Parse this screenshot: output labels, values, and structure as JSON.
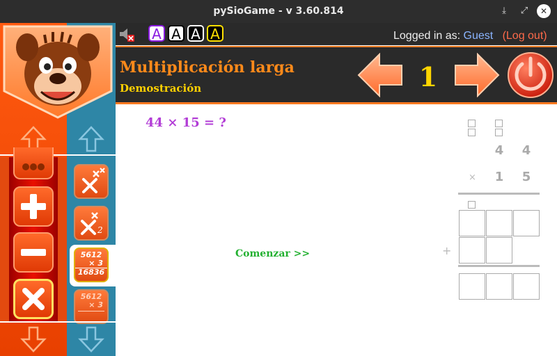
{
  "window": {
    "title": "pySioGame - v 3.60.814"
  },
  "header": {
    "game_title": "Multiplicación larga",
    "subtitle": "Demostración",
    "level": "1",
    "logged_in_label": "Logged in as:",
    "user": "Guest",
    "logout": "(Log out)",
    "font_buttons": [
      "A",
      "A",
      "A",
      "A"
    ]
  },
  "main": {
    "question": "44 × 15 = ?",
    "start_label": "Comenzar >>",
    "multiplicand": [
      "4",
      "4"
    ],
    "multiplier": [
      "1",
      "5"
    ],
    "times_sign": "×",
    "plus_sign": "+"
  },
  "sidebar": {
    "level_buttons": [
      {
        "top": "5612",
        "mid": "× 3",
        "bottom": "16836"
      },
      {
        "top": "5612",
        "mid": "× 3",
        "bottom": ""
      }
    ],
    "level_subscript": "2"
  },
  "colors": {
    "accent_orange": "#ff7a20",
    "title_orange": "#ff8a1a",
    "subtitle_yellow": "#ffd000",
    "question_purple": "#b23dd6",
    "start_green": "#22b030",
    "side_blue": "#2e86a6"
  }
}
